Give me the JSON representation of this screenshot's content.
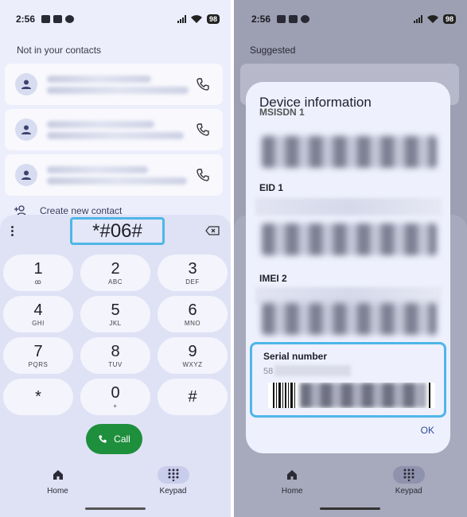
{
  "left": {
    "status": {
      "time": "2:56",
      "battery": "98"
    },
    "section_label": "Not in your contacts",
    "create_contact": "Create new contact",
    "dial_display": "*#06#",
    "keys": [
      {
        "digit": "1",
        "letters": "ꝏ"
      },
      {
        "digit": "2",
        "letters": "ABC"
      },
      {
        "digit": "3",
        "letters": "DEF"
      },
      {
        "digit": "4",
        "letters": "GHI"
      },
      {
        "digit": "5",
        "letters": "JKL"
      },
      {
        "digit": "6",
        "letters": "MNO"
      },
      {
        "digit": "7",
        "letters": "PQRS"
      },
      {
        "digit": "8",
        "letters": "TUV"
      },
      {
        "digit": "9",
        "letters": "WXYZ"
      },
      {
        "digit": "*",
        "letters": ""
      },
      {
        "digit": "0",
        "letters": "+"
      },
      {
        "digit": "#",
        "letters": ""
      }
    ],
    "call_label": "Call",
    "nav": {
      "home": "Home",
      "keypad": "Keypad"
    }
  },
  "right": {
    "status": {
      "time": "2:56",
      "battery": "98"
    },
    "section_label": "Suggested",
    "dialog": {
      "title": "Device information",
      "cut_label": "MSISDN 1",
      "eid_label": "EID 1",
      "imei_label": "IMEI 2",
      "serial_label": "Serial number",
      "serial_prefix": "58",
      "ok_label": "OK"
    },
    "nav": {
      "home": "Home",
      "keypad": "Keypad"
    }
  },
  "colors": {
    "highlight": "#4fb6e8",
    "call_green": "#1e8f3c",
    "dim_overlay": "#9d9fb2"
  }
}
